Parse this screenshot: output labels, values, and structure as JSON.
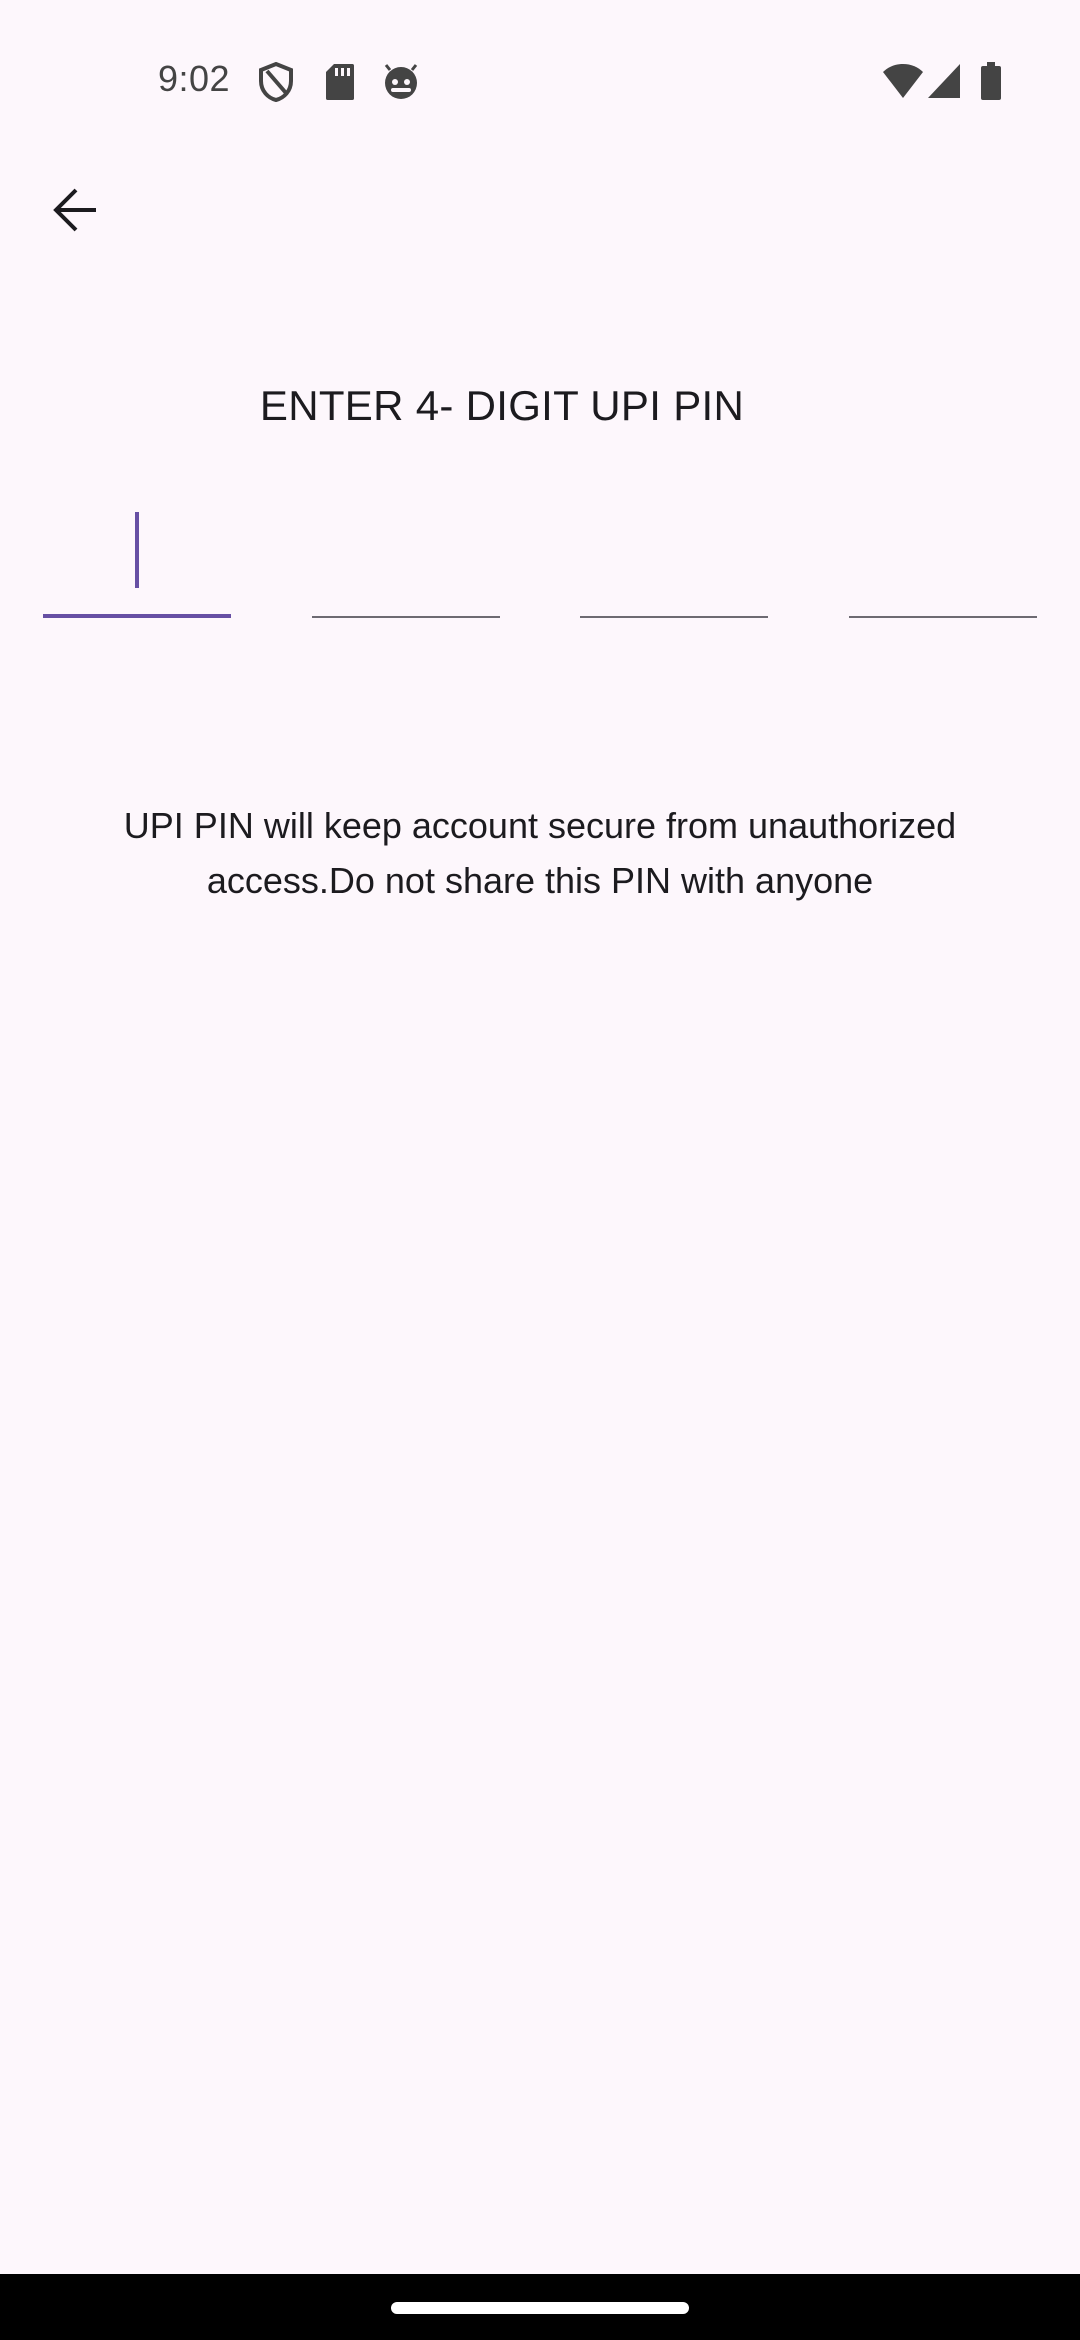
{
  "status_bar": {
    "time": "9:02",
    "icons": [
      "shield-icon",
      "sd-card-icon",
      "android-face-icon",
      "wifi-icon",
      "cell-signal-icon",
      "battery-icon"
    ]
  },
  "header": {
    "back_icon": "arrow-back-icon"
  },
  "pin": {
    "title": "ENTER 4- DIGIT UPI PIN",
    "digits": [
      "",
      "",
      "",
      ""
    ],
    "active_index": 0,
    "note": "UPI PIN will keep account secure from unauthorized access.Do not share this PIN with anyone"
  },
  "colors": {
    "background": "#fdf7fc",
    "accent": "#6750a4",
    "text": "#1c1b1f",
    "divider": "#6d6a72"
  }
}
